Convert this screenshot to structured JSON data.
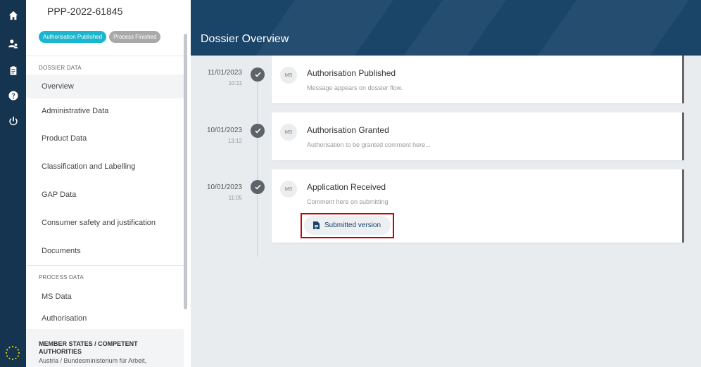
{
  "rail": {
    "icons": [
      "home-icon",
      "users-icon",
      "clipboard-icon",
      "help-icon",
      "power-icon"
    ]
  },
  "sidebar": {
    "dossier_id": "PPP-2022-61845",
    "badges": [
      {
        "label": "Authorisation Published",
        "color": "#1ab6cf"
      },
      {
        "label": "Process Finished",
        "color": "#a9a9a9"
      }
    ],
    "dossier_section_title": "DOSSIER DATA",
    "dossier_items": [
      {
        "label": "Overview",
        "active": true
      },
      {
        "label": "Administrative Data"
      },
      {
        "label": "Product Data"
      },
      {
        "label": "Classification and Labelling"
      },
      {
        "label": "GAP Data"
      },
      {
        "label": "Consumer safety and justification"
      },
      {
        "label": "Documents"
      }
    ],
    "process_section_title": "PROCESS DATA",
    "process_items": [
      {
        "label": "MS Data"
      },
      {
        "label": "Authorisation"
      }
    ],
    "member_states": {
      "title": "MEMBER STATES / COMPETENT AUTHORITIES",
      "country": "Austria",
      "separator": " / ",
      "authority": "Bundesministerium für Arbeit,"
    }
  },
  "header": {
    "title": "Dossier Overview",
    "color": "#1a4468"
  },
  "timeline": [
    {
      "date": "11/01/2023",
      "time": "10:11",
      "avatar": "MS",
      "title": "Authorisation Published",
      "message": "Message appears on dossier flow."
    },
    {
      "date": "10/01/2023",
      "time": "13:12",
      "avatar": "MS",
      "title": "Authorisation Granted",
      "message": "Authorisation to be granted comment here..."
    },
    {
      "date": "10/01/2023",
      "time": "11:05",
      "avatar": "MS",
      "title": "Application Received",
      "message": "Comment here on submitting",
      "button": {
        "label": "Submitted version",
        "icon": "document-icon"
      }
    }
  ]
}
